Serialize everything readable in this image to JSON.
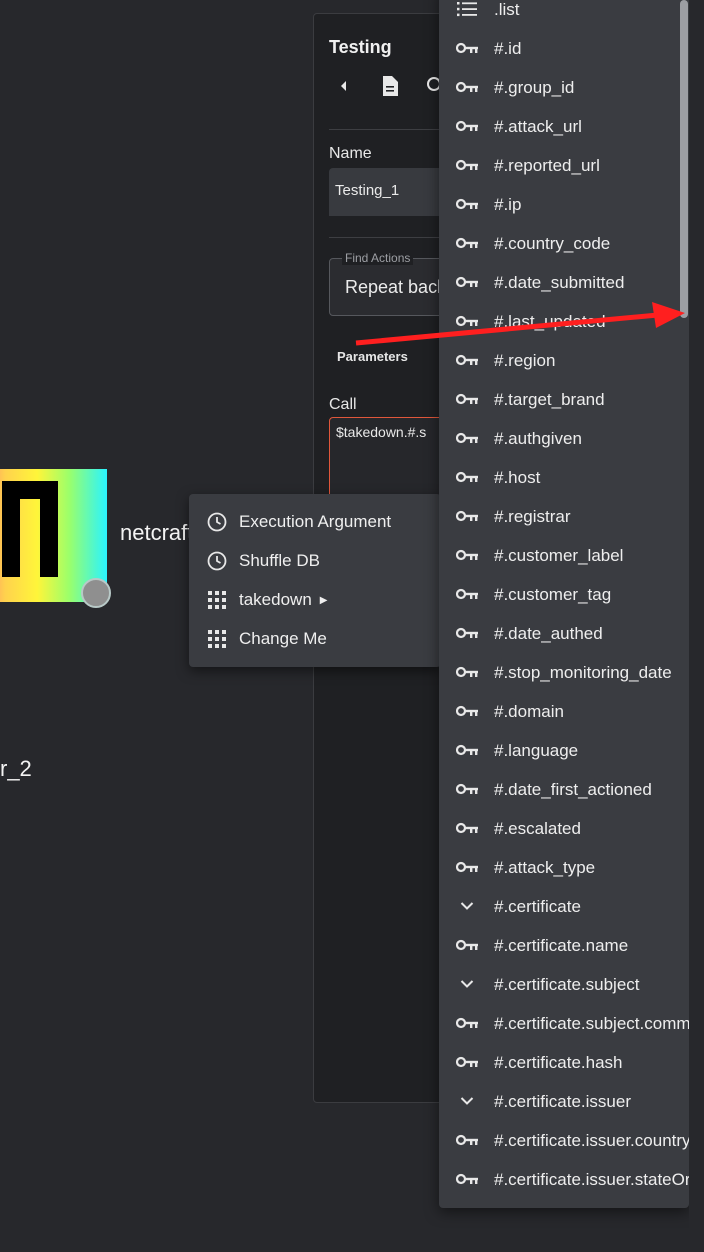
{
  "canvas": {
    "node_label": "netcraft",
    "node2_label": "r_2"
  },
  "panel": {
    "title": "Testing",
    "name_label": "Name",
    "name_value": "Testing_1",
    "find_actions_legend": "Find Actions",
    "find_actions_value": "Repeat back",
    "parameters_label": "Parameters",
    "call_label": "Call",
    "call_value": "$takedown.#.s"
  },
  "context_menu": {
    "items": [
      {
        "label": "Execution Argument",
        "icon": "clock-icon"
      },
      {
        "label": "Shuffle DB",
        "icon": "clock-icon"
      },
      {
        "label": "takedown",
        "icon": "grid-icon",
        "has_submenu": true
      },
      {
        "label": "Change Me",
        "icon": "grid-icon"
      }
    ]
  },
  "dropdown": {
    "items": [
      {
        "label": ".list",
        "icon": "list-icon"
      },
      {
        "label": "#.id",
        "icon": "key-icon"
      },
      {
        "label": "#.group_id",
        "icon": "key-icon"
      },
      {
        "label": "#.attack_url",
        "icon": "key-icon"
      },
      {
        "label": "#.reported_url",
        "icon": "key-icon"
      },
      {
        "label": "#.ip",
        "icon": "key-icon"
      },
      {
        "label": "#.country_code",
        "icon": "key-icon"
      },
      {
        "label": "#.date_submitted",
        "icon": "key-icon"
      },
      {
        "label": "#.last_updated",
        "icon": "key-icon"
      },
      {
        "label": "#.region",
        "icon": "key-icon"
      },
      {
        "label": "#.target_brand",
        "icon": "key-icon"
      },
      {
        "label": "#.authgiven",
        "icon": "key-icon"
      },
      {
        "label": "#.host",
        "icon": "key-icon"
      },
      {
        "label": "#.registrar",
        "icon": "key-icon"
      },
      {
        "label": "#.customer_label",
        "icon": "key-icon"
      },
      {
        "label": "#.customer_tag",
        "icon": "key-icon"
      },
      {
        "label": "#.date_authed",
        "icon": "key-icon"
      },
      {
        "label": "#.stop_monitoring_date",
        "icon": "key-icon"
      },
      {
        "label": "#.domain",
        "icon": "key-icon"
      },
      {
        "label": "#.language",
        "icon": "key-icon"
      },
      {
        "label": "#.date_first_actioned",
        "icon": "key-icon"
      },
      {
        "label": "#.escalated",
        "icon": "key-icon"
      },
      {
        "label": "#.attack_type",
        "icon": "key-icon"
      },
      {
        "label": "#.certificate",
        "icon": "chevron-down-icon"
      },
      {
        "label": "#.certificate.name",
        "icon": "key-icon"
      },
      {
        "label": "#.certificate.subject",
        "icon": "chevron-down-icon"
      },
      {
        "label": "#.certificate.subject.common_name",
        "icon": "key-icon"
      },
      {
        "label": "#.certificate.hash",
        "icon": "key-icon"
      },
      {
        "label": "#.certificate.issuer",
        "icon": "chevron-down-icon"
      },
      {
        "label": "#.certificate.issuer.country",
        "icon": "key-icon"
      },
      {
        "label": "#.certificate.issuer.stateOrProvinceName",
        "icon": "key-icon"
      }
    ]
  },
  "colors": {
    "background": "#26272b",
    "menu_bg": "#3a3c41",
    "accent_border": "#e0573b",
    "annotation_arrow": "#ff1f1f"
  }
}
